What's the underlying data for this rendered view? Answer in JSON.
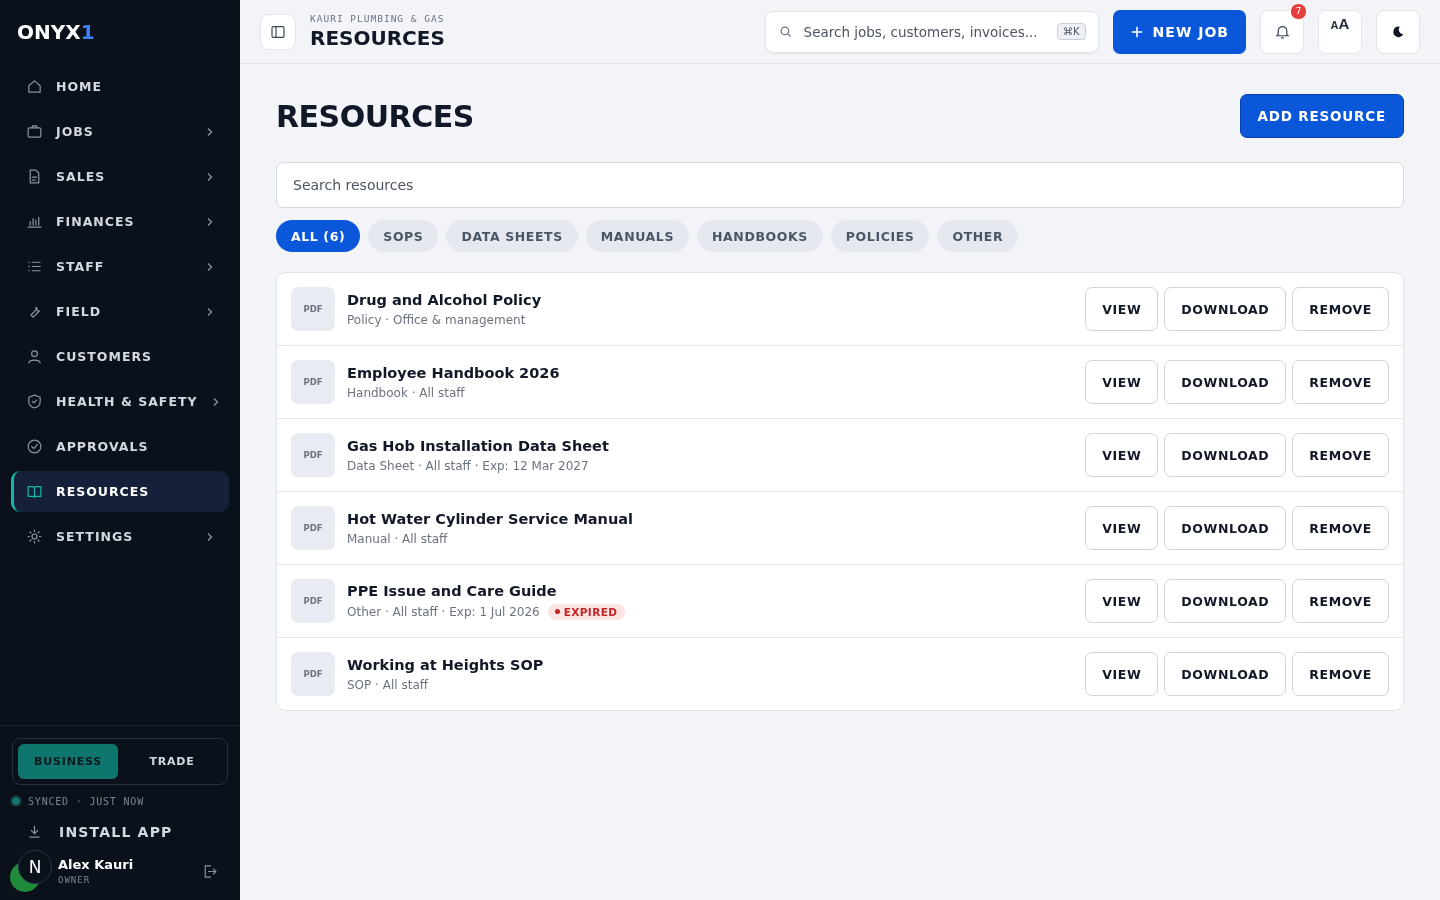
{
  "brand": {
    "name": "ONYX",
    "accent": "1"
  },
  "nav": [
    {
      "label": "HOME",
      "kind": "home",
      "has_children": false,
      "selected": false
    },
    {
      "label": "JOBS",
      "kind": "briefcase",
      "has_children": true,
      "selected": false
    },
    {
      "label": "SALES",
      "kind": "document",
      "has_children": true,
      "selected": false
    },
    {
      "label": "FINANCES",
      "kind": "chart",
      "has_children": true,
      "selected": false
    },
    {
      "label": "STAFF",
      "kind": "list",
      "has_children": true,
      "selected": false
    },
    {
      "label": "FIELD",
      "kind": "wrench",
      "has_children": true,
      "selected": false
    },
    {
      "label": "CUSTOMERS",
      "kind": "person",
      "has_children": false,
      "selected": false
    },
    {
      "label": "HEALTH & SAFETY",
      "kind": "shield",
      "has_children": true,
      "selected": false
    },
    {
      "label": "APPROVALS",
      "kind": "check",
      "has_children": false,
      "selected": false
    },
    {
      "label": "RESOURCES",
      "kind": "book",
      "has_children": false,
      "selected": true
    },
    {
      "label": "SETTINGS",
      "kind": "sun",
      "has_children": true,
      "selected": false
    }
  ],
  "mode_switch": [
    {
      "label": "BUSINESS",
      "selected": true
    },
    {
      "label": "TRADE",
      "selected": false
    }
  ],
  "sync_status": "SYNCED · JUST NOW",
  "install_app": "INSTALL APP",
  "user": {
    "name": "Alex Kauri",
    "role": "OWNER",
    "overlay_badge": "N"
  },
  "header": {
    "company": "KAURI PLUMBING & GAS",
    "title": "RESOURCES",
    "search": {
      "placeholder": "Search jobs, customers, invoices...",
      "shortcut": "⌘K"
    },
    "new_job": "NEW JOB",
    "notifications": "7",
    "font_size": {
      "small": "A",
      "large": "A"
    }
  },
  "page": {
    "title": "RESOURCES",
    "add_button": "ADD RESOURCE",
    "search": {
      "placeholder": "Search resources"
    }
  },
  "filters": [
    {
      "label": "ALL (6)",
      "selected": true
    },
    {
      "label": "SOPS",
      "selected": false
    },
    {
      "label": "DATA SHEETS",
      "selected": false
    },
    {
      "label": "MANUALS",
      "selected": false
    },
    {
      "label": "HANDBOOKS",
      "selected": false
    },
    {
      "label": "POLICIES",
      "selected": false
    },
    {
      "label": "OTHER",
      "selected": false
    }
  ],
  "resources": [
    {
      "file_type": "PDF",
      "title": "Drug and Alcohol Policy",
      "meta": "Policy · Office & management",
      "actions": [
        "VIEW",
        "DOWNLOAD",
        "REMOVE"
      ]
    },
    {
      "file_type": "PDF",
      "title": "Employee Handbook 2026",
      "meta": "Handbook · All staff",
      "actions": [
        "VIEW",
        "DOWNLOAD",
        "REMOVE"
      ]
    },
    {
      "file_type": "PDF",
      "title": "Gas Hob Installation Data Sheet",
      "meta": "Data Sheet · All staff · Exp: 12 Mar 2027",
      "actions": [
        "VIEW",
        "DOWNLOAD",
        "REMOVE"
      ]
    },
    {
      "file_type": "PDF",
      "title": "Hot Water Cylinder Service Manual",
      "meta": "Manual · All staff",
      "actions": [
        "VIEW",
        "DOWNLOAD",
        "REMOVE"
      ]
    },
    {
      "file_type": "PDF",
      "title": "PPE Issue and Care Guide",
      "meta": "Other · All staff · Exp: 1 Jul 2026",
      "badge": "EXPIRED",
      "actions": [
        "VIEW",
        "DOWNLOAD",
        "REMOVE"
      ]
    },
    {
      "file_type": "PDF",
      "title": "Working at Heights SOP",
      "meta": "SOP · All staff",
      "actions": [
        "VIEW",
        "DOWNLOAD",
        "REMOVE"
      ]
    }
  ]
}
